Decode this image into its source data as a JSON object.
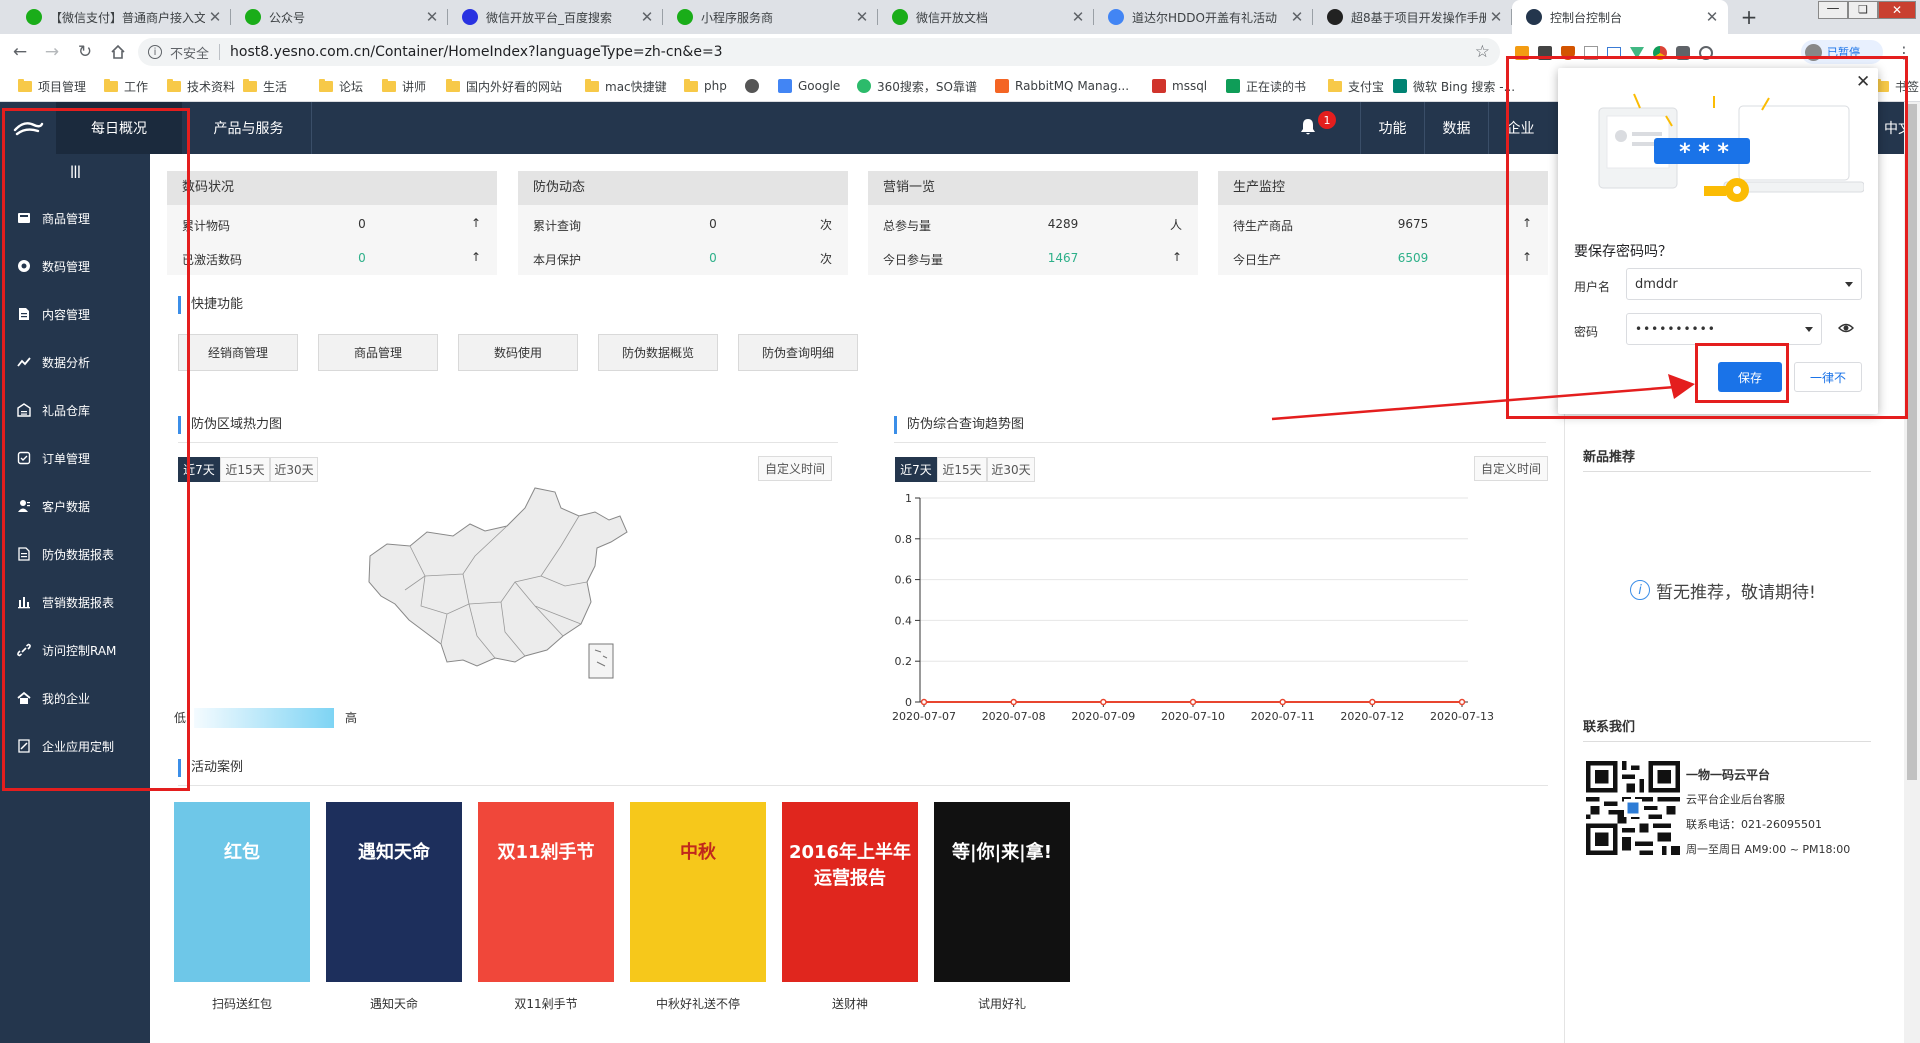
{
  "browser": {
    "tabs": [
      {
        "label": "【微信支付】普通商户接入文",
        "fav": "wechat-icon",
        "color": "#1aad19"
      },
      {
        "label": "公众号",
        "fav": "wechat-icon",
        "color": "#1aad19"
      },
      {
        "label": "微信开放平台_百度搜索",
        "fav": "baidu-icon",
        "color": "#2932e1"
      },
      {
        "label": "小程序服务商",
        "fav": "wechat-icon",
        "color": "#1aad19"
      },
      {
        "label": "微信开放文档",
        "fav": "wechat-icon",
        "color": "#1aad19"
      },
      {
        "label": "道达尔HDDO开盖有礼活动",
        "fav": "globe-icon",
        "color": "#4285f4"
      },
      {
        "label": "超8基于项目开发操作手册",
        "fav": "notion-icon",
        "color": "#222222"
      },
      {
        "label": "控制台控制台",
        "fav": "logo-icon",
        "color": "#24364d",
        "active": true
      }
    ],
    "new_tab": "+",
    "security": "不安全",
    "url": "host8.yesno.com.cn/Container/HomeIndex?languageType=zh-cn&e=3",
    "profile_label": "已暂停",
    "bookmarks": [
      {
        "label": "项目管理",
        "type": "folder"
      },
      {
        "label": "工作",
        "type": "folder"
      },
      {
        "label": "技术资料",
        "type": "folder"
      },
      {
        "label": "生活",
        "type": "folder"
      },
      {
        "label": "论坛",
        "type": "folder"
      },
      {
        "label": "讲师",
        "type": "folder"
      },
      {
        "label": "国内外好看的网站",
        "type": "folder"
      },
      {
        "label": "mac快捷键",
        "type": "folder"
      },
      {
        "label": "php",
        "type": "folder"
      },
      {
        "label": "",
        "type": "globe"
      },
      {
        "label": "Google",
        "type": "google"
      },
      {
        "label": "360搜索，SO靠谱",
        "type": "360"
      },
      {
        "label": "RabbitMQ Manag...",
        "type": "rabbit"
      },
      {
        "label": "mssql",
        "type": "pen"
      },
      {
        "label": "正在读的书",
        "type": "book"
      },
      {
        "label": "支付宝",
        "type": "folder"
      },
      {
        "label": "微软 Bing 搜索 -...",
        "type": "bing"
      },
      {
        "label": "书签",
        "type": "folder"
      }
    ]
  },
  "app": {
    "nav": {
      "overview": "每日概况",
      "products": "产品与服务"
    },
    "notif_count": "1",
    "header_right": [
      "功能",
      "数据",
      "企业"
    ],
    "lang": "中文",
    "sidebar_toggle": "|||",
    "sidebar": [
      {
        "label": "商品管理",
        "icon": "goods-icon"
      },
      {
        "label": "数码管理",
        "icon": "code-icon"
      },
      {
        "label": "内容管理",
        "icon": "content-icon"
      },
      {
        "label": "数据分析",
        "icon": "analytics-icon"
      },
      {
        "label": "礼品仓库",
        "icon": "warehouse-icon"
      },
      {
        "label": "订单管理",
        "icon": "order-icon"
      },
      {
        "label": "客户数据",
        "icon": "customer-icon"
      },
      {
        "label": "防伪数据报表",
        "icon": "report-icon"
      },
      {
        "label": "营销数据报表",
        "icon": "chart-icon"
      },
      {
        "label": "访问控制RAM",
        "icon": "link-icon"
      },
      {
        "label": "我的企业",
        "icon": "enterprise-icon"
      },
      {
        "label": "企业应用定制",
        "icon": "custom-icon"
      }
    ],
    "cards": [
      {
        "title": "数码状况",
        "rows": [
          {
            "label": "累计物码",
            "value": "0",
            "unit": "↑",
            "green": false
          },
          {
            "label": "已激活数码",
            "value": "0",
            "unit": "↑",
            "green": true
          }
        ]
      },
      {
        "title": "防伪动态",
        "rows": [
          {
            "label": "累计查询",
            "value": "0",
            "unit": "次",
            "green": false
          },
          {
            "label": "本月保护",
            "value": "0",
            "unit": "次",
            "green": true
          }
        ]
      },
      {
        "title": "营销一览",
        "rows": [
          {
            "label": "总参与量",
            "value": "4289",
            "unit": "人",
            "green": false
          },
          {
            "label": "今日参与量",
            "value": "1467",
            "unit": "↑",
            "green": true
          }
        ]
      },
      {
        "title": "生产监控",
        "rows": [
          {
            "label": "待生产商品",
            "value": "9675",
            "unit": "↑",
            "green": false
          },
          {
            "label": "今日生产",
            "value": "6509",
            "unit": "↑",
            "green": true
          }
        ]
      }
    ],
    "quick_title": "快捷功能",
    "quick": [
      "经销商管理",
      "商品管理",
      "数码使用",
      "防伪数据概览",
      "防伪查询明细"
    ],
    "heatmap": {
      "title": "防伪区域热力图",
      "ranges": [
        "近7天",
        "近15天",
        "近30天"
      ],
      "custom": "自定义时间",
      "legend_low": "低",
      "legend_high": "高"
    },
    "trend": {
      "title": "防伪综合查询趋势图",
      "ranges": [
        "近7天",
        "近15天",
        "近30天"
      ],
      "custom": "自定义时间"
    },
    "cases_title": "活动案例",
    "cases": [
      {
        "label": "扫码送红包",
        "art": "红包",
        "bg": "#6ec7e8"
      },
      {
        "label": "遇知天命",
        "art": "遇知天命",
        "bg": "#1d2f5c"
      },
      {
        "label": "双11剁手节",
        "art": "双11剁手节",
        "bg": "#f0473a"
      },
      {
        "label": "中秋好礼送不停",
        "art": "中秋",
        "bg": "#f6c81b"
      },
      {
        "label": "送财神",
        "art": "2016年上半年运营报告",
        "bg": "#e0261e"
      },
      {
        "label": "试用好礼",
        "art": "等|你|来|拿!",
        "bg": "#111111"
      }
    ],
    "right": {
      "new_title": "新品推荐",
      "empty": "暂无推荐，敬请期待!",
      "contact_title": "联系我们",
      "contact": [
        "一物一码云平台",
        "云平台企业后台客服",
        "联系电话：021-26095501",
        "周一至周日 AM9:00 ~ PM18:00"
      ]
    }
  },
  "password_popup": {
    "title": "要保存密码吗？",
    "username_label": "用户名",
    "username": "dmddr",
    "password_label": "密码",
    "password": "••••••••••",
    "save": "保存",
    "never": "一律不",
    "stars": "* * *"
  },
  "chart_data": {
    "type": "line",
    "x": [
      "2020-07-07",
      "2020-07-08",
      "2020-07-09",
      "2020-07-10",
      "2020-07-11",
      "2020-07-12",
      "2020-07-13"
    ],
    "series": [
      {
        "values": [
          0,
          0,
          0,
          0,
          0,
          0,
          0
        ]
      }
    ],
    "yticks": [
      "1",
      "0.8",
      "0.6",
      "0.4",
      "0.2",
      "0"
    ],
    "ylim": [
      0,
      1
    ],
    "grid": true,
    "line_color": "#e8452f",
    "xlabel": "",
    "ylabel": "",
    "title": ""
  }
}
